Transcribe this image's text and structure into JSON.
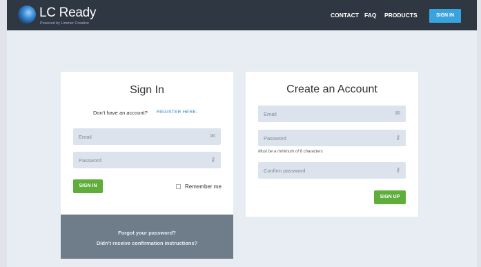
{
  "header": {
    "brand": "LC Ready",
    "tagline": "Powered by Limmer Creative",
    "nav": {
      "contact": "CONTACT",
      "faq": "FAQ",
      "products": "PRODUCTS",
      "signin": "SIGN IN"
    }
  },
  "signin": {
    "title": "Sign In",
    "no_account_text": "Don’t have an account?",
    "register_link": "REGISTER HERE.",
    "email_placeholder": "Email",
    "password_placeholder": "Password",
    "submit_label": "SIGN IN",
    "remember_label": "Remember me",
    "forgot_link": "Forgot your password?",
    "confirm_link": "Didn’t receive confirmation instructions?"
  },
  "create": {
    "title": "Create an Account",
    "email_placeholder": "Email",
    "password_placeholder": "Password",
    "password_hint": "Must be a minimum of 8 characters",
    "confirm_placeholder": "Confirm password",
    "submit_label": "SIGN UP"
  },
  "icons": {
    "email": "envelope-icon",
    "password": "key-icon"
  },
  "colors": {
    "header_bg": "#2f3743",
    "accent_blue": "#39a3de",
    "button_green": "#5fae3b",
    "field_bg": "#dde3ec",
    "footer_bg": "#6f7c89"
  }
}
